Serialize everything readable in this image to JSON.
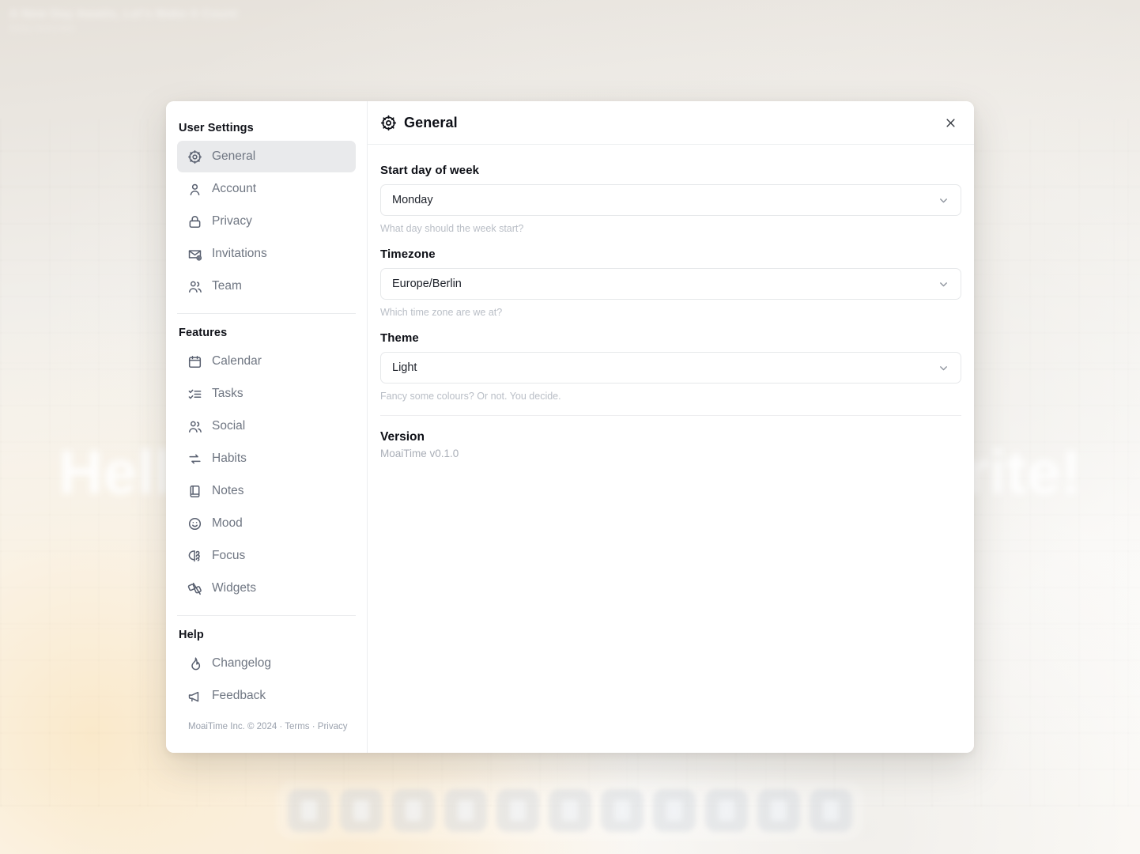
{
  "background": {
    "header_line1": "A New Day Awaits, Let's Make It Count",
    "header_line2": "Daily Overview",
    "greeting_left": "Hello",
    "greeting_right": "write!",
    "dock_item_count": 11
  },
  "modal": {
    "sidebar": {
      "groups": [
        {
          "title": "User Settings",
          "items": [
            {
              "label": "General",
              "icon": "gear-icon",
              "active": true
            },
            {
              "label": "Account",
              "icon": "user-icon",
              "active": false
            },
            {
              "label": "Privacy",
              "icon": "lock-icon",
              "active": false
            },
            {
              "label": "Invitations",
              "icon": "mail-plus-icon",
              "active": false
            },
            {
              "label": "Team",
              "icon": "users-icon",
              "active": false
            }
          ]
        },
        {
          "title": "Features",
          "items": [
            {
              "label": "Calendar",
              "icon": "calendar-icon",
              "active": false
            },
            {
              "label": "Tasks",
              "icon": "checklist-icon",
              "active": false
            },
            {
              "label": "Social",
              "icon": "users-icon",
              "active": false
            },
            {
              "label": "Habits",
              "icon": "repeat-icon",
              "active": false
            },
            {
              "label": "Notes",
              "icon": "notebook-icon",
              "active": false
            },
            {
              "label": "Mood",
              "icon": "smiley-icon",
              "active": false
            },
            {
              "label": "Focus",
              "icon": "brain-icon",
              "active": false
            },
            {
              "label": "Widgets",
              "icon": "widgets-icon",
              "active": false
            }
          ]
        },
        {
          "title": "Help",
          "items": [
            {
              "label": "Changelog",
              "icon": "flame-icon",
              "active": false
            },
            {
              "label": "Feedback",
              "icon": "megaphone-icon",
              "active": false
            }
          ]
        }
      ],
      "footer": "MoaiTime Inc. © 2024 · Terms · Privacy"
    },
    "header": {
      "title": "General",
      "title_icon": "gear-icon",
      "close_icon": "close-icon"
    },
    "fields": [
      {
        "label": "Start day of week",
        "value": "Monday",
        "hint": "What day should the week start?",
        "chevron_icon": "chevron-down-icon"
      },
      {
        "label": "Timezone",
        "value": "Europe/Berlin",
        "hint": "Which time zone are we at?",
        "chevron_icon": "chevron-down-icon"
      },
      {
        "label": "Theme",
        "value": "Light",
        "hint": "Fancy some colours? Or not. You decide.",
        "chevron_icon": "chevron-down-icon"
      }
    ],
    "version": {
      "title": "Version",
      "value": "MoaiTime v0.1.0"
    }
  },
  "colors": {
    "active_item_bg": "#e9eaec",
    "modal_bg": "#ffffff",
    "text_primary": "#0d0f16",
    "text_muted": "#6f7682",
    "hint": "#b9bec6",
    "border": "#e6e8ea"
  }
}
